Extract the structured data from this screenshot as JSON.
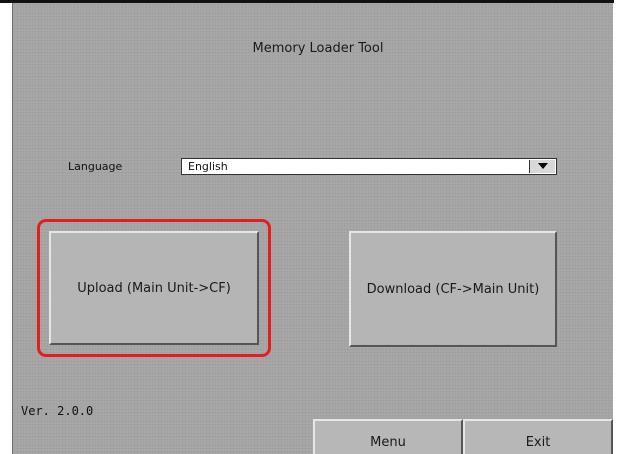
{
  "window": {
    "title": "Memory Loader Tool"
  },
  "language": {
    "label": "Language",
    "selected": "English",
    "arrow_icon": "dropdown-arrow-icon"
  },
  "actions": {
    "upload_label": "Upload (Main Unit->CF)",
    "download_label": "Download (CF->Main Unit)",
    "highlight_color": "#e41e1e"
  },
  "footer": {
    "version": "Ver. 2.0.0",
    "menu_label": "Menu",
    "exit_label": "Exit"
  }
}
